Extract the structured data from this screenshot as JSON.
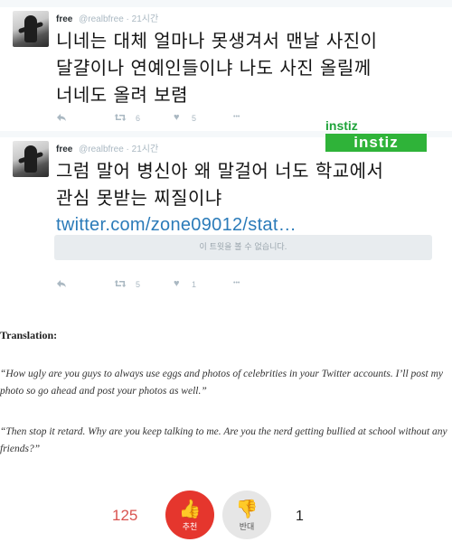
{
  "tweets": [
    {
      "name": "free",
      "handle": "@realbfree",
      "time": "21시간",
      "lines": [
        "니네는 대체 얼마나 못생겨서 맨날 사진이",
        "달걀이나 연예인들이냐 나도 사진 올릴께",
        "너네도 올려 보렴"
      ],
      "retweets": "6",
      "likes": "5"
    },
    {
      "name": "free",
      "handle": "@realbfree",
      "time": "21시간",
      "lines": [
        "그럼 말어 병신아 왜 말걸어 너도 학교에서",
        "관심 못받는 찌질이냐"
      ],
      "link": "twitter.com/zone09012/stat…",
      "withheld_text": "이 트윗을 볼 수 없습니다.",
      "retweets": "5",
      "likes": "1"
    }
  ],
  "icons": {
    "reply": "reply-icon",
    "retweet": "retweet-icon",
    "like": "heart-icon",
    "more": "more-icon",
    "like_glyph": "♥",
    "more_glyph": "•••",
    "up_glyph": "👍",
    "down_glyph": "👎"
  },
  "watermark": {
    "text": "instiz",
    "box_text": "instiz"
  },
  "translation": {
    "heading": "Translation:",
    "quote1": "“How ugly are you guys to always use eggs and photos of celebrities in your Twitter accounts. I’ll post my photo so go ahead and post your photos as well.”",
    "quote2": "“Then stop it retard. Why are you keep talking to me. Are you the nerd getting bullied at school without any friends?”"
  },
  "votes": {
    "up_count": "125",
    "up_label": "추천",
    "down_label": "반대",
    "down_count": "1",
    "up_color": "#e5362d",
    "down_color": "#e6e6e6"
  }
}
